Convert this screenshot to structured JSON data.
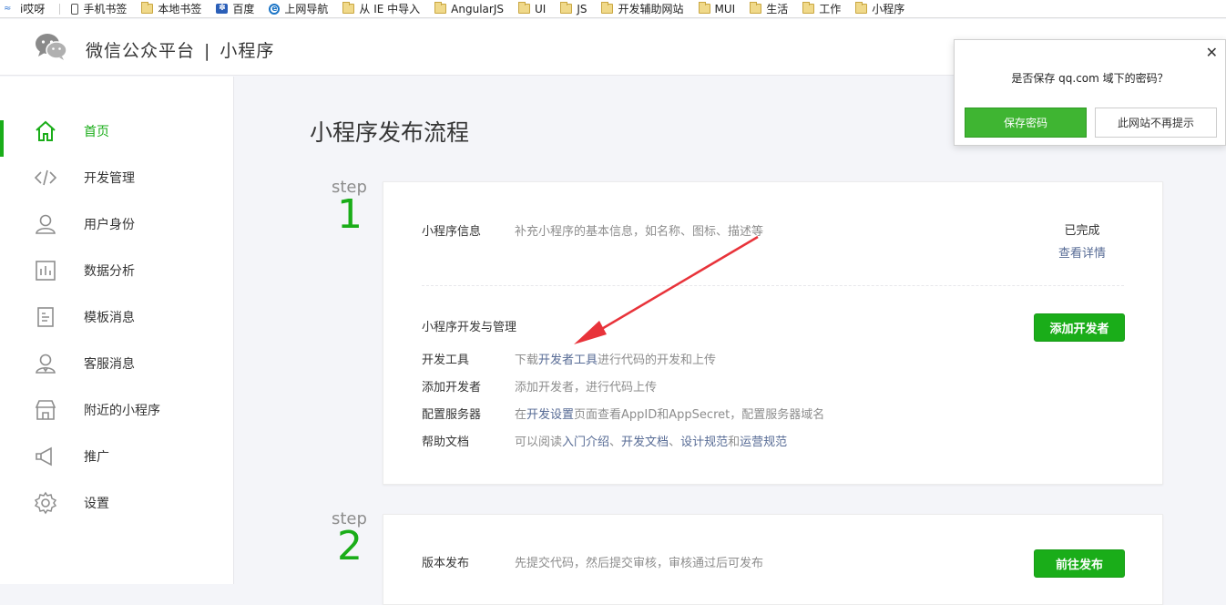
{
  "bookmarks": [
    {
      "label": "i哎呀",
      "icon": "wave-icon"
    },
    {
      "label": "手机书签",
      "icon": "phone-icon"
    },
    {
      "label": "本地书签",
      "icon": "folder-icon"
    },
    {
      "label": "百度",
      "icon": "baidu-paw-icon"
    },
    {
      "label": "上网导航",
      "icon": "ie-icon"
    },
    {
      "label": "从 IE 中导入",
      "icon": "folder-icon"
    },
    {
      "label": "AngularJS",
      "icon": "folder-icon"
    },
    {
      "label": "UI",
      "icon": "folder-icon"
    },
    {
      "label": "JS",
      "icon": "folder-icon"
    },
    {
      "label": "开发辅助网站",
      "icon": "folder-icon"
    },
    {
      "label": "MUI",
      "icon": "folder-icon"
    },
    {
      "label": "生活",
      "icon": "folder-icon"
    },
    {
      "label": "工作",
      "icon": "folder-icon"
    },
    {
      "label": "小程序",
      "icon": "folder-icon"
    }
  ],
  "header": {
    "brand": "微信公众平台",
    "separator": "|",
    "product": "小程序"
  },
  "sidebar": {
    "items": [
      {
        "label": "首页",
        "icon": "home-icon",
        "active": true
      },
      {
        "label": "开发管理",
        "icon": "code-icon"
      },
      {
        "label": "用户身份",
        "icon": "user-icon"
      },
      {
        "label": "数据分析",
        "icon": "chart-icon"
      },
      {
        "label": "模板消息",
        "icon": "template-icon"
      },
      {
        "label": "客服消息",
        "icon": "service-icon"
      },
      {
        "label": "附近的小程序",
        "icon": "store-icon"
      },
      {
        "label": "推广",
        "icon": "megaphone-icon"
      },
      {
        "label": "设置",
        "icon": "gear-icon"
      }
    ]
  },
  "main": {
    "title": "小程序发布流程",
    "step1": {
      "step_word": "step",
      "number": "1",
      "info_key": "小程序信息",
      "info_value": "补充小程序的基本信息，如名称、图标、描述等",
      "status_done": "已完成",
      "status_link": "查看详情",
      "dev_heading": "小程序开发与管理",
      "add_dev_button": "添加开发者",
      "rows": [
        {
          "key": "开发工具",
          "prefix": "下载",
          "link": "开发者工具",
          "suffix": "进行代码的开发和上传"
        },
        {
          "key": "添加开发者",
          "prefix": "添加开发者，进行代码上传",
          "link": "",
          "suffix": ""
        },
        {
          "key": "配置服务器",
          "prefix": "在",
          "link": "开发设置",
          "suffix": "页面查看AppID和AppSecret，配置服务器域名"
        },
        {
          "key": "帮助文档",
          "prefix": "可以阅读",
          "link": "入门介绍",
          "suffix": "、"
        }
      ],
      "help_links": [
        "开发文档",
        "、",
        "设计规范",
        "和",
        "运营规范"
      ]
    },
    "step2": {
      "step_word": "step",
      "number": "2",
      "key": "版本发布",
      "value": "先提交代码，然后提交审核，审核通过后可发布",
      "button": "前往发布"
    }
  },
  "popup": {
    "message": "是否保存 qq.com 域下的密码？",
    "save_button": "保存密码",
    "never_button": "此网站不再提示",
    "close": "✕"
  },
  "colors": {
    "accent": "#1aad19",
    "link": "#576b95",
    "arrow": "#e8333a"
  }
}
